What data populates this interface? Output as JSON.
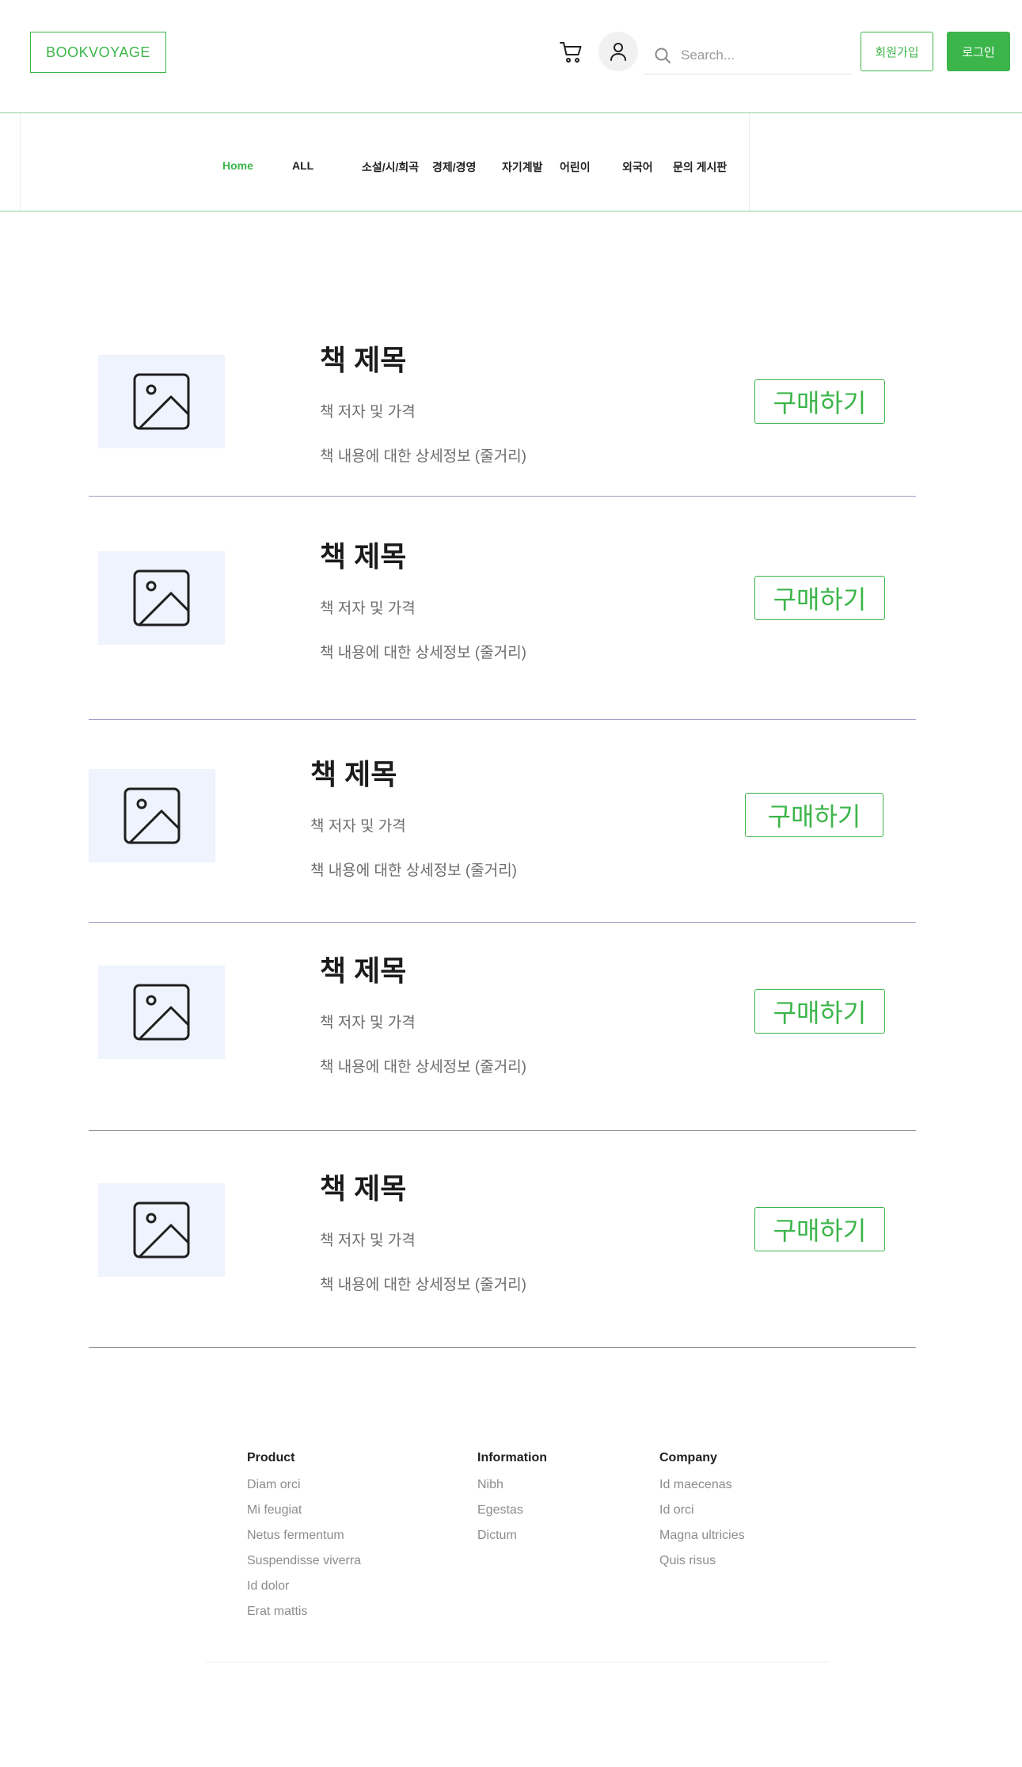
{
  "header": {
    "logo": "BOOKVOYAGE",
    "cart_icon": "cart-icon",
    "user_icon": "user-icon",
    "search": {
      "placeholder": "Search...",
      "value": ""
    },
    "signup_label": "회원가입",
    "login_label": "로그인",
    "accent_color": "#3cb54a"
  },
  "nav": {
    "items": [
      {
        "label": "Home",
        "active": true
      },
      {
        "label": "ALL"
      },
      {
        "label": "소설/시/희곡"
      },
      {
        "label": "경제/경영"
      },
      {
        "label": "자기계발"
      },
      {
        "label": "어린이"
      },
      {
        "label": "외국어"
      },
      {
        "label": "문의 게시판"
      }
    ]
  },
  "books": [
    {
      "title": "책 제목",
      "meta": "책 저자 및 가격",
      "desc": "책 내용에 대한 상세정보 (줄거리)",
      "buy_label": "구매하기",
      "image_icon": "image-placeholder-icon"
    },
    {
      "title": "책 제목",
      "meta": "책 저자 및 가격",
      "desc": "책 내용에 대한 상세정보 (줄거리)",
      "buy_label": "구매하기",
      "image_icon": "image-placeholder-icon"
    },
    {
      "title": "책 제목",
      "meta": "책 저자 및 가격",
      "desc": "책 내용에 대한 상세정보 (줄거리)",
      "buy_label": "구매하기",
      "image_icon": "image-placeholder-icon"
    },
    {
      "title": "책 제목",
      "meta": "책 저자 및 가격",
      "desc": "책 내용에 대한 상세정보 (줄거리)",
      "buy_label": "구매하기",
      "image_icon": "image-placeholder-icon"
    },
    {
      "title": "책 제목",
      "meta": "책 저자 및 가격",
      "desc": "책 내용에 대한 상세정보 (줄거리)",
      "buy_label": "구매하기",
      "image_icon": "image-placeholder-icon"
    }
  ],
  "footer": {
    "columns": [
      {
        "heading": "Product",
        "links": [
          "Diam orci",
          "Mi feugiat",
          "Netus fermentum",
          "Suspendisse viverra",
          "Id dolor",
          "Erat mattis"
        ]
      },
      {
        "heading": "Information",
        "links": [
          "Nibh",
          "Egestas",
          "Dictum"
        ]
      },
      {
        "heading": "Company",
        "links": [
          "Id maecenas",
          "Id orci",
          "Magna ultricies",
          "Quis risus"
        ]
      }
    ]
  }
}
